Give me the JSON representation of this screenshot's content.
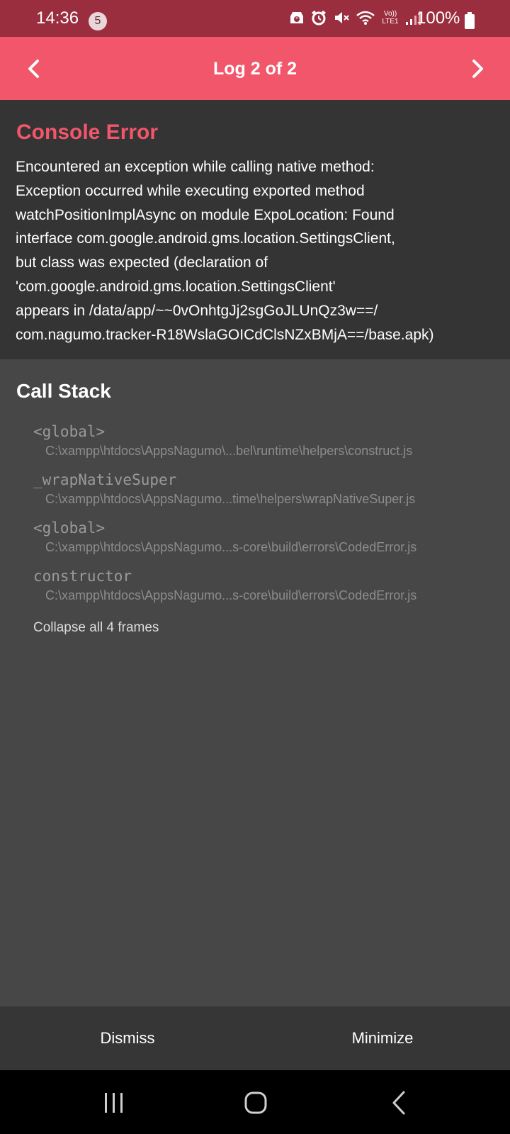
{
  "status_bar": {
    "time": "14:36",
    "notification_count": "5",
    "battery": "100%",
    "network_label_top": "Vo))",
    "network_label_bottom": "LTE1",
    "icons": [
      "android-auto-icon",
      "alarm-icon",
      "mute-icon",
      "wifi-icon",
      "volte-icon",
      "signal-icon",
      "battery-icon"
    ]
  },
  "header": {
    "title": "Log 2 of 2",
    "prev_icon": "chevron-left-icon",
    "next_icon": "chevron-right-icon",
    "accent_color": "#f2566a"
  },
  "error": {
    "title": "Console Error",
    "message": "Encountered an exception while calling native method:\nException occurred while executing exported method\nwatchPositionImplAsync on module ExpoLocation: Found\ninterface com.google.android.gms.location.SettingsClient,\nbut class was expected (declaration of\n'com.google.android.gms.location.SettingsClient'\nappears in /data/app/~~0vOnhtgJj2sgGoJLUnQz3w==/\ncom.nagumo.tracker-R18WslaGOICdClsNZxBMjA==/base.apk)"
  },
  "call_stack": {
    "title": "Call Stack",
    "frames": [
      {
        "name": "<global>",
        "path": "C:\\xampp\\htdocs\\AppsNagumo\\...bel\\runtime\\helpers\\construct.js"
      },
      {
        "name": "_wrapNativeSuper",
        "path": "C:\\xampp\\htdocs\\AppsNagumo...time\\helpers\\wrapNativeSuper.js"
      },
      {
        "name": "<global>",
        "path": "C:\\xampp\\htdocs\\AppsNagumo...s-core\\build\\errors\\CodedError.js"
      },
      {
        "name": "constructor",
        "path": "C:\\xampp\\htdocs\\AppsNagumo...s-core\\build\\errors\\CodedError.js"
      }
    ],
    "collapse_label": "Collapse all 4 frames"
  },
  "footer": {
    "dismiss_label": "Dismiss",
    "minimize_label": "Minimize"
  },
  "system_nav": {
    "recents_icon": "recents-icon",
    "home_icon": "home-icon",
    "back_icon": "back-icon"
  }
}
